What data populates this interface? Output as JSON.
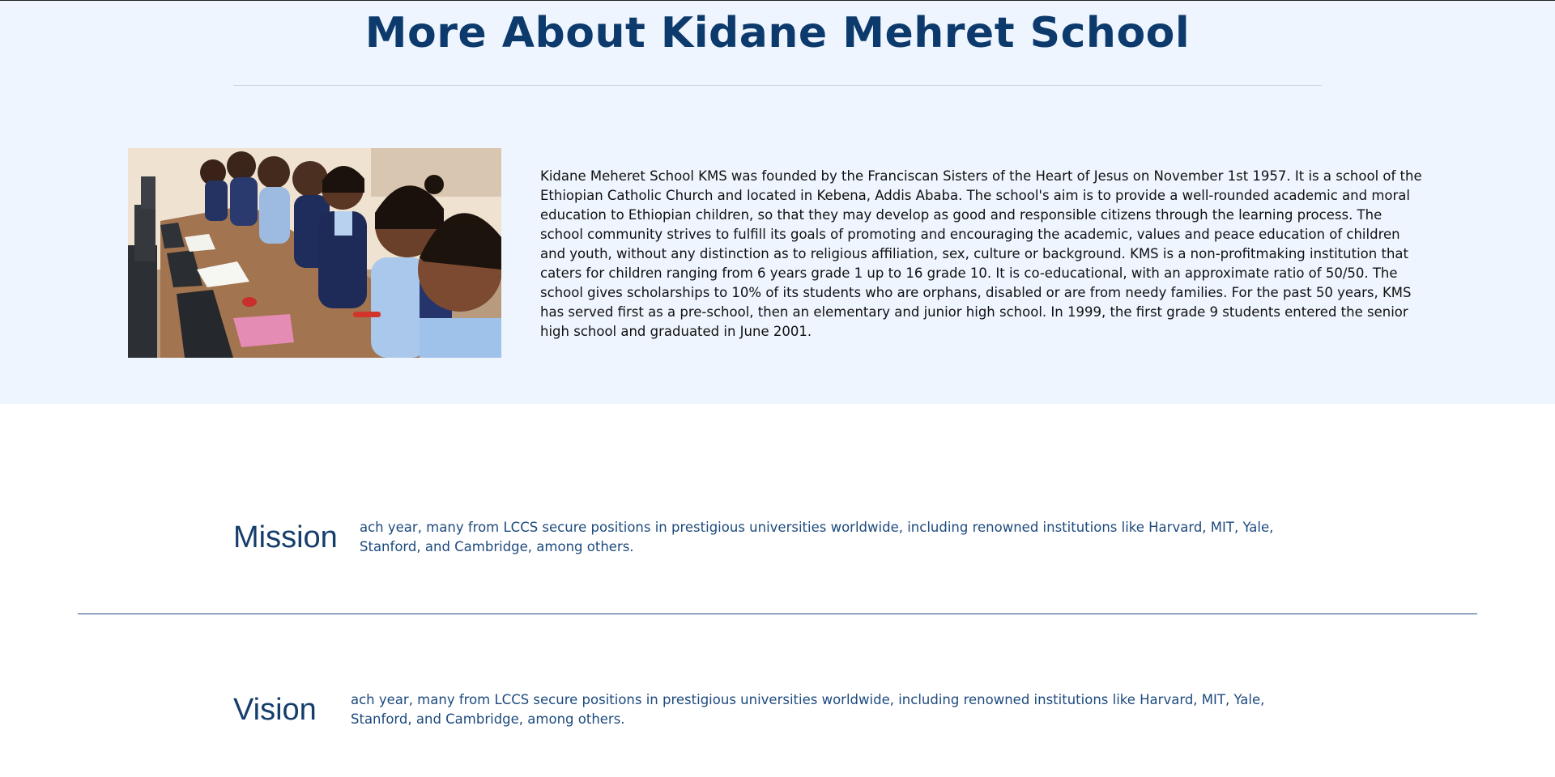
{
  "about": {
    "title": "More About Kidane Mehret School",
    "body": "Kidane Meheret School KMS was founded by the Franciscan Sisters of the Heart of Jesus on November 1st 1957. It is a school of the Ethiopian Catholic Church and located in Kebena, Addis Ababa. The school's aim is to provide a well-rounded academic and moral education to Ethiopian children, so that they may develop as good and responsible citizens through the learning process. The school community strives to fulfill its goals of promoting and encouraging the academic, values and peace education of children and youth, without any distinction as to religious affiliation, sex, culture or background. KMS is a non-profitmaking institution that caters for children ranging from 6 years grade 1 up to 16 grade 10. It is co-educational, with an approximate ratio of 50/50. The school gives scholarships to 10% of its students who are orphans, disabled or are from needy families. For the past 50 years, KMS has served first as a pre-school, then an elementary and junior high school. In 1999, the first grade 9 students entered the senior high school and graduated in June 2001.",
    "image_alt": "Students working at computers in a classroom"
  },
  "mission": {
    "heading": "Mission",
    "text": "ach year, many from LCCS secure positions in prestigious universities worldwide, including renowned institutions like Harvard, MIT, Yale, Stanford, and Cambridge, among others."
  },
  "vision": {
    "heading": "Vision",
    "text": "ach year, many from LCCS secure positions in prestigious universities worldwide, including renowned institutions like Harvard, MIT, Yale, Stanford, and Cambridge, among others."
  },
  "colors": {
    "section_background": "#eef5fe",
    "title_navy": "#0d3a6c",
    "accent_blue": "#1d4a7e"
  }
}
